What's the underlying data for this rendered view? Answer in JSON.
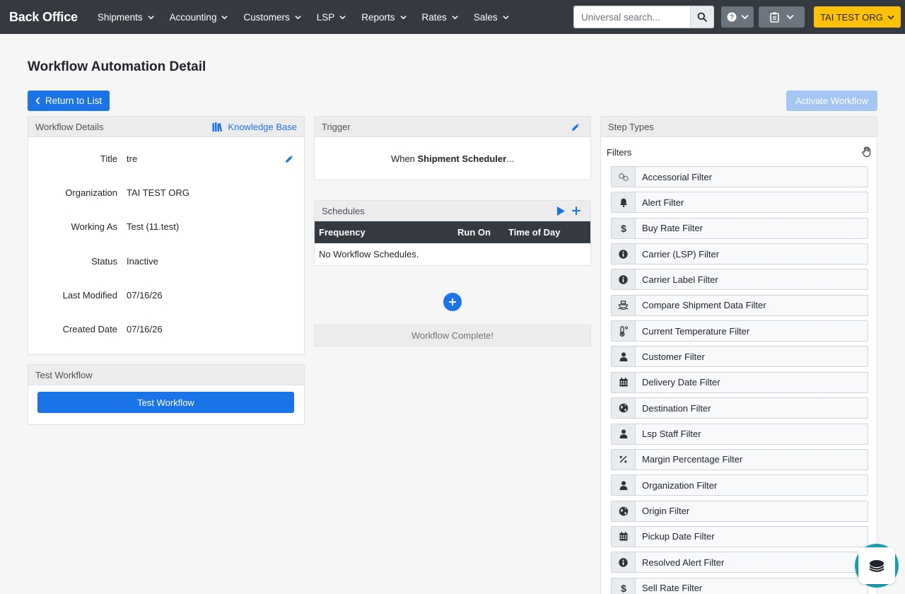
{
  "nav": {
    "brand": "Back Office",
    "menu": [
      {
        "label": "Shipments"
      },
      {
        "label": "Accounting"
      },
      {
        "label": "Customers"
      },
      {
        "label": "LSP"
      },
      {
        "label": "Reports"
      },
      {
        "label": "Rates"
      },
      {
        "label": "Sales"
      }
    ],
    "search_placeholder": "Universal search...",
    "org_label": "TAI TEST ORG"
  },
  "page": {
    "title": "Workflow Automation Detail",
    "return_label": "Return to List",
    "activate_label": "Activate Workflow"
  },
  "details": {
    "header": "Workflow Details",
    "kb_label": "Knowledge Base",
    "rows": [
      {
        "label": "Title",
        "value": "tre"
      },
      {
        "label": "Organization",
        "value": "TAI TEST ORG"
      },
      {
        "label": "Working As",
        "value": "Test (11.test)"
      },
      {
        "label": "Status",
        "value": "Inactive"
      },
      {
        "label": "Last Modified",
        "value": "07/16/26"
      },
      {
        "label": "Created Date",
        "value": "07/16/26"
      }
    ]
  },
  "test": {
    "header": "Test Workflow",
    "button": "Test Workflow"
  },
  "trigger": {
    "header": "Trigger",
    "prefix": "When ",
    "name": "Shipment Scheduler",
    "suffix": "..."
  },
  "schedules": {
    "header": "Schedules",
    "columns": [
      "Frequency",
      "Run On",
      "Time of Day"
    ],
    "empty": "No Workflow Schedules."
  },
  "complete_label": "Workflow Complete!",
  "steps": {
    "header": "Step Types",
    "section": "Filters",
    "filters": [
      {
        "label": "Accessorial Filter",
        "icon": "gears-icon"
      },
      {
        "label": "Alert Filter",
        "icon": "bell-icon"
      },
      {
        "label": "Buy Rate Filter",
        "icon": "dollar-icon"
      },
      {
        "label": "Carrier (LSP) Filter",
        "icon": "info-icon"
      },
      {
        "label": "Carrier Label Filter",
        "icon": "info-icon"
      },
      {
        "label": "Compare Shipment Data Filter",
        "icon": "ship-icon"
      },
      {
        "label": "Current Temperature Filter",
        "icon": "thermometer-icon"
      },
      {
        "label": "Customer Filter",
        "icon": "user-icon"
      },
      {
        "label": "Delivery Date Filter",
        "icon": "calendar-icon"
      },
      {
        "label": "Destination Filter",
        "icon": "globe-icon"
      },
      {
        "label": "Lsp Staff Filter",
        "icon": "user-icon"
      },
      {
        "label": "Margin Percentage Filter",
        "icon": "percent-icon"
      },
      {
        "label": "Organization Filter",
        "icon": "user-icon"
      },
      {
        "label": "Origin Filter",
        "icon": "globe-icon"
      },
      {
        "label": "Pickup Date Filter",
        "icon": "calendar-icon"
      },
      {
        "label": "Resolved Alert Filter",
        "icon": "info-icon"
      },
      {
        "label": "Sell Rate Filter",
        "icon": "dollar-icon"
      }
    ]
  },
  "colors": {
    "primary": "#1a73e8",
    "navbar": "#343a40",
    "org_button": "#ffc107",
    "chat": "#15a0b2"
  }
}
